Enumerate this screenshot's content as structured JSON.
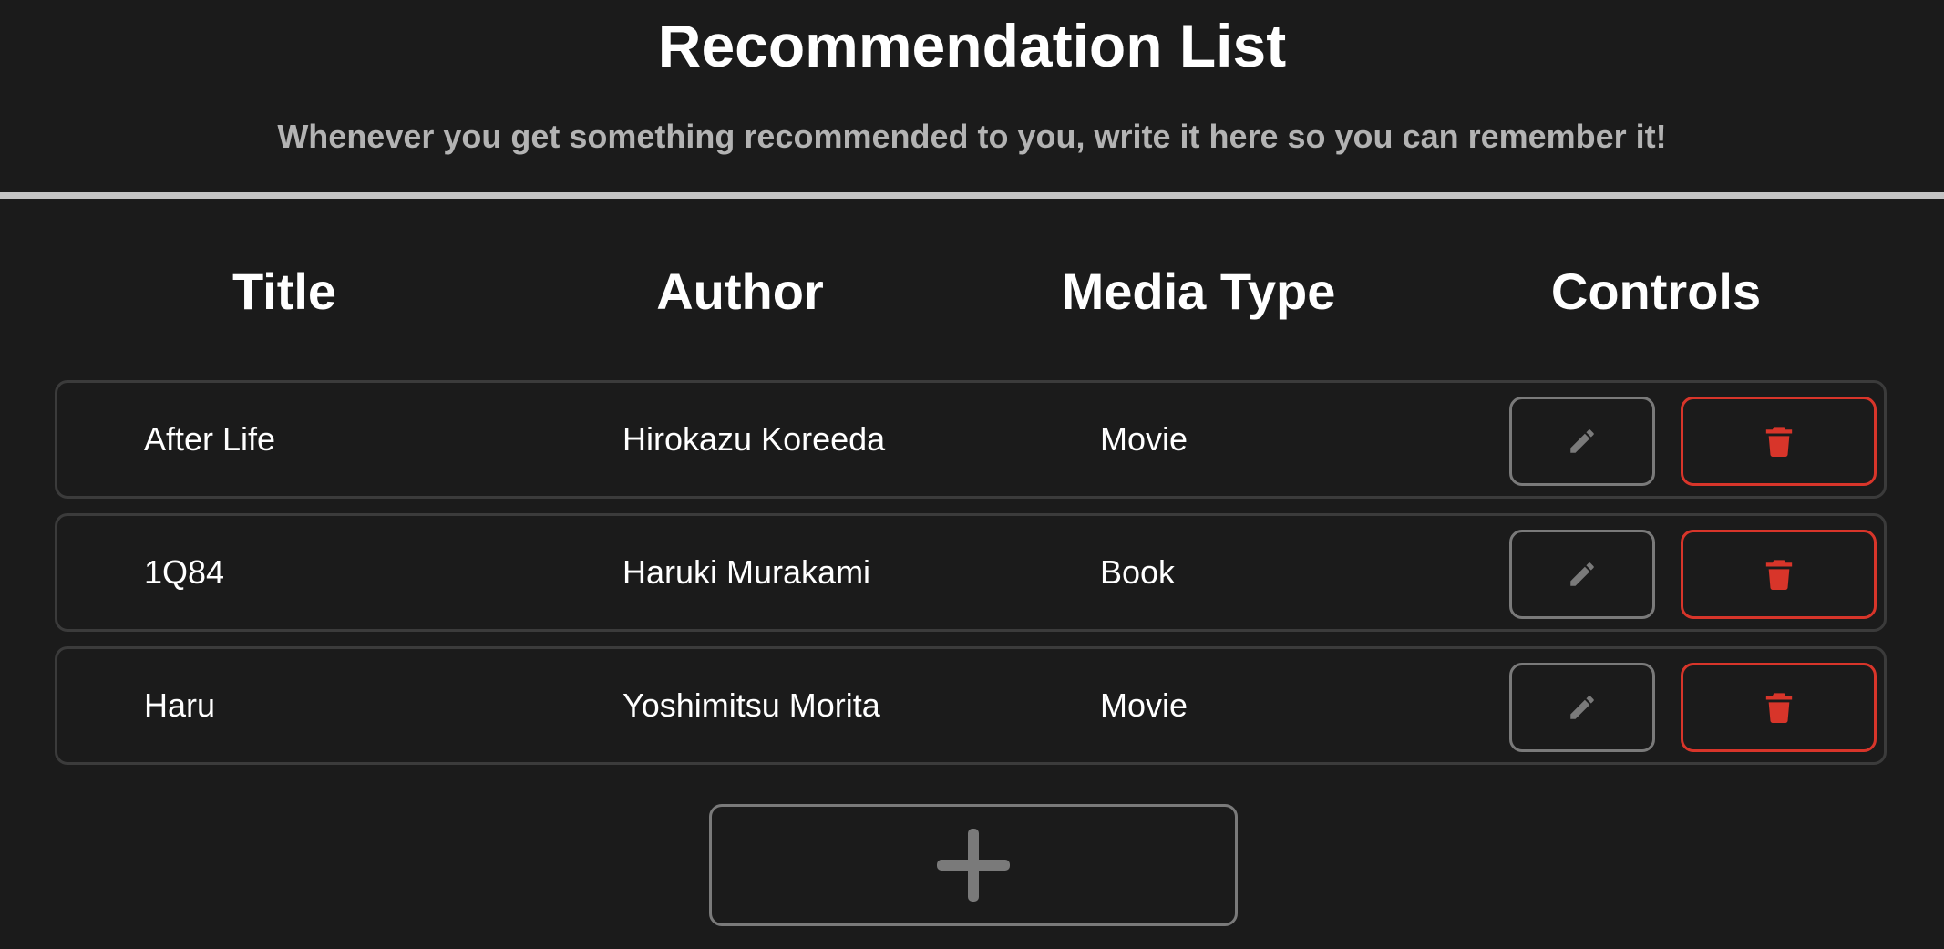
{
  "header": {
    "title": "Recommendation List",
    "subtitle": "Whenever you get something recommended to you, write it here so you can remember it!"
  },
  "table": {
    "columns": [
      "Title",
      "Author",
      "Media Type",
      "Controls"
    ],
    "rows": [
      {
        "title": "After Life",
        "author": "Hirokazu Koreeda",
        "media_type": "Movie"
      },
      {
        "title": "1Q84",
        "author": "Haruki Murakami",
        "media_type": "Book"
      },
      {
        "title": "Haru",
        "author": "Yoshimitsu Morita",
        "media_type": "Movie"
      }
    ]
  },
  "icons": {
    "edit": "pencil-icon",
    "delete": "trash-icon",
    "add": "plus-icon"
  },
  "colors": {
    "background": "#1b1b1b",
    "text": "#ffffff",
    "subtitle": "#b3b3b3",
    "divider": "#c4c4c4",
    "row_border": "#3b3b3b",
    "edit_border": "#7a7a7a",
    "delete_accent": "#d8352a"
  }
}
